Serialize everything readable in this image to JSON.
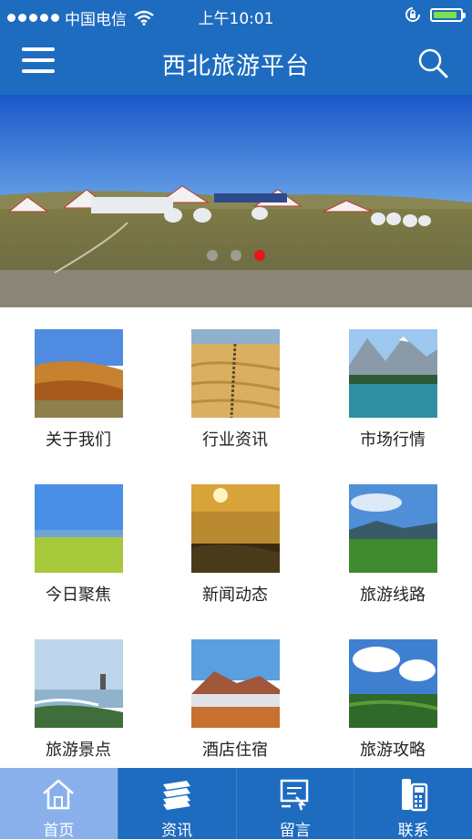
{
  "status_bar": {
    "carrier": "中国电信",
    "time": "上午10:01",
    "signal_icon": "signal-dots-icon",
    "wifi_icon": "wifi-icon",
    "lock_icon": "rotation-lock-icon",
    "battery_icon": "battery-icon",
    "battery_level": 0.9
  },
  "header": {
    "title": "西北旅游平台",
    "menu_icon": "hamburger-menu-icon",
    "search_icon": "search-icon"
  },
  "banner": {
    "slide_count": 3,
    "active_index": 2,
    "active_color": "#e8161b"
  },
  "grid": {
    "items": [
      {
        "label": "关于我们"
      },
      {
        "label": "行业资讯"
      },
      {
        "label": "市场行情"
      },
      {
        "label": "今日聚焦"
      },
      {
        "label": "新闻动态"
      },
      {
        "label": "旅游线路"
      },
      {
        "label": "旅游景点"
      },
      {
        "label": "酒店住宿"
      },
      {
        "label": "旅游攻略"
      }
    ]
  },
  "tab_bar": {
    "tabs": [
      {
        "label": "首页",
        "icon": "home-icon",
        "active": true
      },
      {
        "label": "资讯",
        "icon": "news-stack-icon",
        "active": false
      },
      {
        "label": "留言",
        "icon": "message-board-icon",
        "active": false
      },
      {
        "label": "联系",
        "icon": "phone-icon",
        "active": false
      }
    ]
  },
  "colors": {
    "primary": "#1e6cc0",
    "tab_active": "#8ab0ec",
    "battery": "#7ce04a"
  }
}
